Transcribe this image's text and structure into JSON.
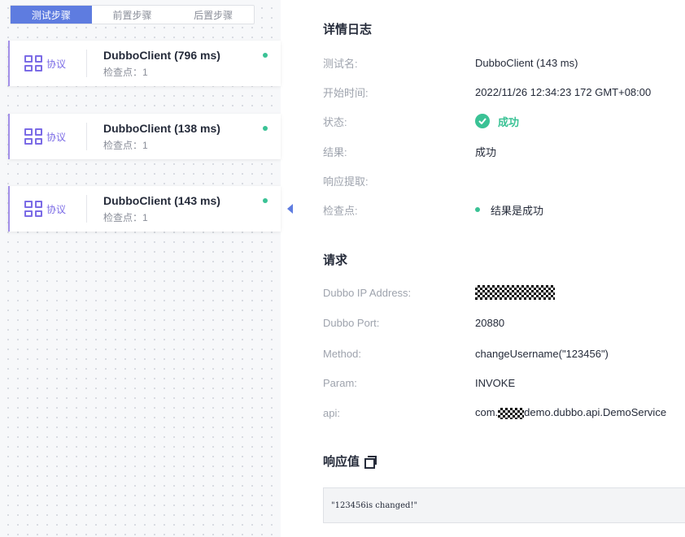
{
  "tabs": [
    {
      "label": "测试步骤",
      "active": true
    },
    {
      "label": "前置步骤",
      "active": false
    },
    {
      "label": "后置步骤",
      "active": false
    }
  ],
  "steps": [
    {
      "protocol": "协议",
      "title": "DubboClient (796 ms)",
      "checkpoints": "检查点：1",
      "status": "success"
    },
    {
      "protocol": "协议",
      "title": "DubboClient (138 ms)",
      "checkpoints": "检查点：1",
      "status": "success"
    },
    {
      "protocol": "协议",
      "title": "DubboClient (143 ms)",
      "checkpoints": "检查点：1",
      "status": "success",
      "selected": true
    }
  ],
  "detail": {
    "title": "详情日志",
    "test_name_label": "测试名:",
    "test_name": "DubboClient (143 ms)",
    "start_time_label": "开始时间:",
    "start_time": "2022/11/26 12:34:23 172 GMT+08:00",
    "status_label": "状态:",
    "status": "成功",
    "result_label": "结果:",
    "result": "成功",
    "extract_label": "响应提取:",
    "checkpoint_label": "检查点:",
    "checkpoint": "结果是成功"
  },
  "request": {
    "title": "请求",
    "ip_label": "Dubbo IP Address:",
    "port_label": "Dubbo Port:",
    "port": "20880",
    "method_label": "Method:",
    "method": "changeUsername(\"123456\")",
    "param_label": "Param:",
    "param": "INVOKE",
    "api_label": "api:",
    "api_prefix": "com.",
    "api_suffix": "demo.dubbo.api.DemoService"
  },
  "response": {
    "title": "响应值",
    "value": "\"123456is changed!\""
  },
  "colors": {
    "accent": "#5e7ce0",
    "protocol": "#7b6be6",
    "success": "#3ac295"
  }
}
